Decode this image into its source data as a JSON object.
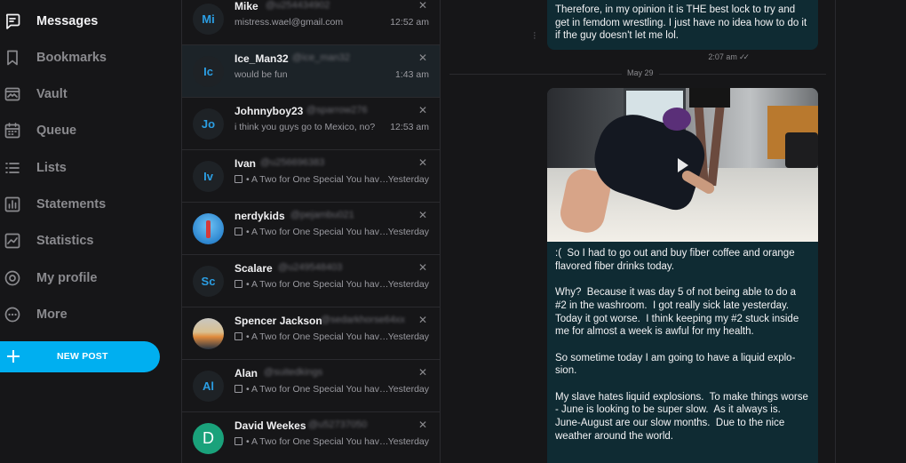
{
  "nav": {
    "items": [
      {
        "label": "Messages",
        "icon": "message-square-icon",
        "active": true
      },
      {
        "label": "Bookmarks",
        "icon": "bookmark-icon"
      },
      {
        "label": "Vault",
        "icon": "image-folder-icon"
      },
      {
        "label": "Queue",
        "icon": "calendar-icon"
      },
      {
        "label": "Lists",
        "icon": "list-icon"
      },
      {
        "label": "Statements",
        "icon": "bar-chart-icon"
      },
      {
        "label": "Statistics",
        "icon": "line-chart-icon"
      },
      {
        "label": "My profile",
        "icon": "user-circle-icon"
      },
      {
        "label": "More",
        "icon": "more-circle-icon"
      }
    ],
    "new_post_label": "NEW POST"
  },
  "conversations": [
    {
      "initials": "Mi",
      "name": "Mike",
      "handle": "@u254434902",
      "preview": "mistress.wael@gmail.com",
      "time": "12:52 am"
    },
    {
      "initials": "Ic",
      "name": "Ice_Man32",
      "handle": "@ice_man32",
      "preview": "would be fun",
      "time": "1:43 am",
      "selected": true
    },
    {
      "initials": "Jo",
      "name": "Johnnyboy23",
      "handle": "@sparrow276",
      "preview": "i think you guys go to Mexico, no?",
      "time": "12:53 am"
    },
    {
      "initials": "Iv",
      "name": "Ivan",
      "handle": "@u256696383",
      "preview": "• A Two for One Special  You have...",
      "time": "Yesterday",
      "media": true
    },
    {
      "initials": "",
      "name": "nerdykids",
      "handle": "@pejambu021",
      "preview": "• A Two for One Special  You have...",
      "time": "Yesterday",
      "media": true,
      "avatar": "photo-blue"
    },
    {
      "initials": "Sc",
      "name": "Scalare",
      "handle": "@u249548403",
      "preview": "• A Two for One Special  You have...",
      "time": "Yesterday",
      "media": true
    },
    {
      "initials": "",
      "name": "Spencer Jackson",
      "handle": "@sedarkhorse64xx",
      "preview": "• A Two for One Special  You have...",
      "time": "Yesterday",
      "media": true,
      "avatar": "photo-sunset"
    },
    {
      "initials": "Al",
      "name": "Alan",
      "handle": "@suitedkings",
      "preview": "• A Two for One Special  You have...",
      "time": "Yesterday",
      "media": true
    },
    {
      "initials": "D",
      "name": "David Weekes",
      "handle": "@u52737050",
      "preview": "• A Two for One Special  You have...",
      "time": "Yesterday",
      "media": true,
      "avatar": "green"
    }
  ],
  "chat": {
    "top_message": "Therefore, in my opinion it is THE best lock to try and get in femdom wrestling. I just have no idea how to do it if the guy doesn't let me lol.",
    "top_time": "2:07 am",
    "date_separator": "May 29",
    "main_message": ":(  So I had to go out and buy fiber coffee and orange flavored fiber drinks today.\n\nWhy?  Because it was day 5 of not being able to do a #2 in the washroom.  I got really sick late yesterday.  Today it got worse.  I think keeping my #2 stuck inside me for almost a week is awful for my health.\n\nSo sometime today I am going to have a liquid explo-sion.\n\nMy slave hates liquid explosions.  To make things worse - June is looking to be super slow.  As it always is.  June-August are our slow months.  Due to the nice weather around the world.",
    "colors": {
      "accent": "#00aff0",
      "bubble": "#0f2b33",
      "background": "#161618"
    }
  }
}
